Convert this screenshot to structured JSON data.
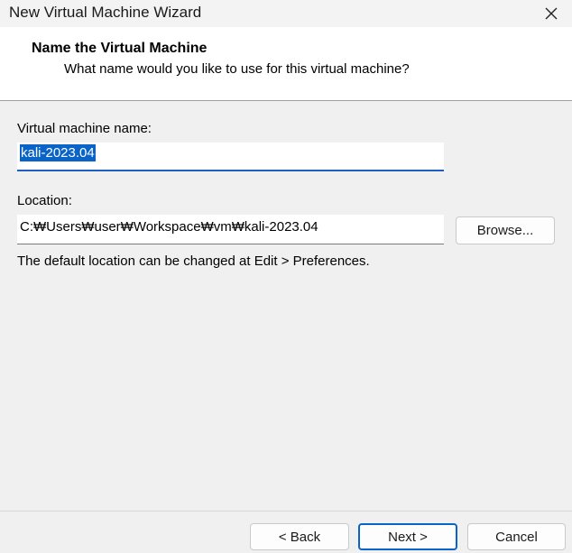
{
  "window": {
    "title": "New Virtual Machine Wizard",
    "close_icon": "close-icon"
  },
  "header": {
    "title": "Name the Virtual Machine",
    "subtitle": "What name would you like to use for this virtual machine?"
  },
  "form": {
    "name_label": "Virtual machine name:",
    "name_value": "kali-2023.04",
    "location_label": "Location:",
    "location_value": "C:₩Users₩user₩Workspace₩vm₩kali-2023.04",
    "browse_label": "Browse...",
    "hint": "The default location can be changed at Edit > Preferences."
  },
  "footer": {
    "back_label": "< Back",
    "next_label": "Next >",
    "cancel_label": "Cancel"
  },
  "colors": {
    "accent": "#0a64c8",
    "header_bg": "#ffffff",
    "dialog_bg": "#f0f0f0"
  }
}
